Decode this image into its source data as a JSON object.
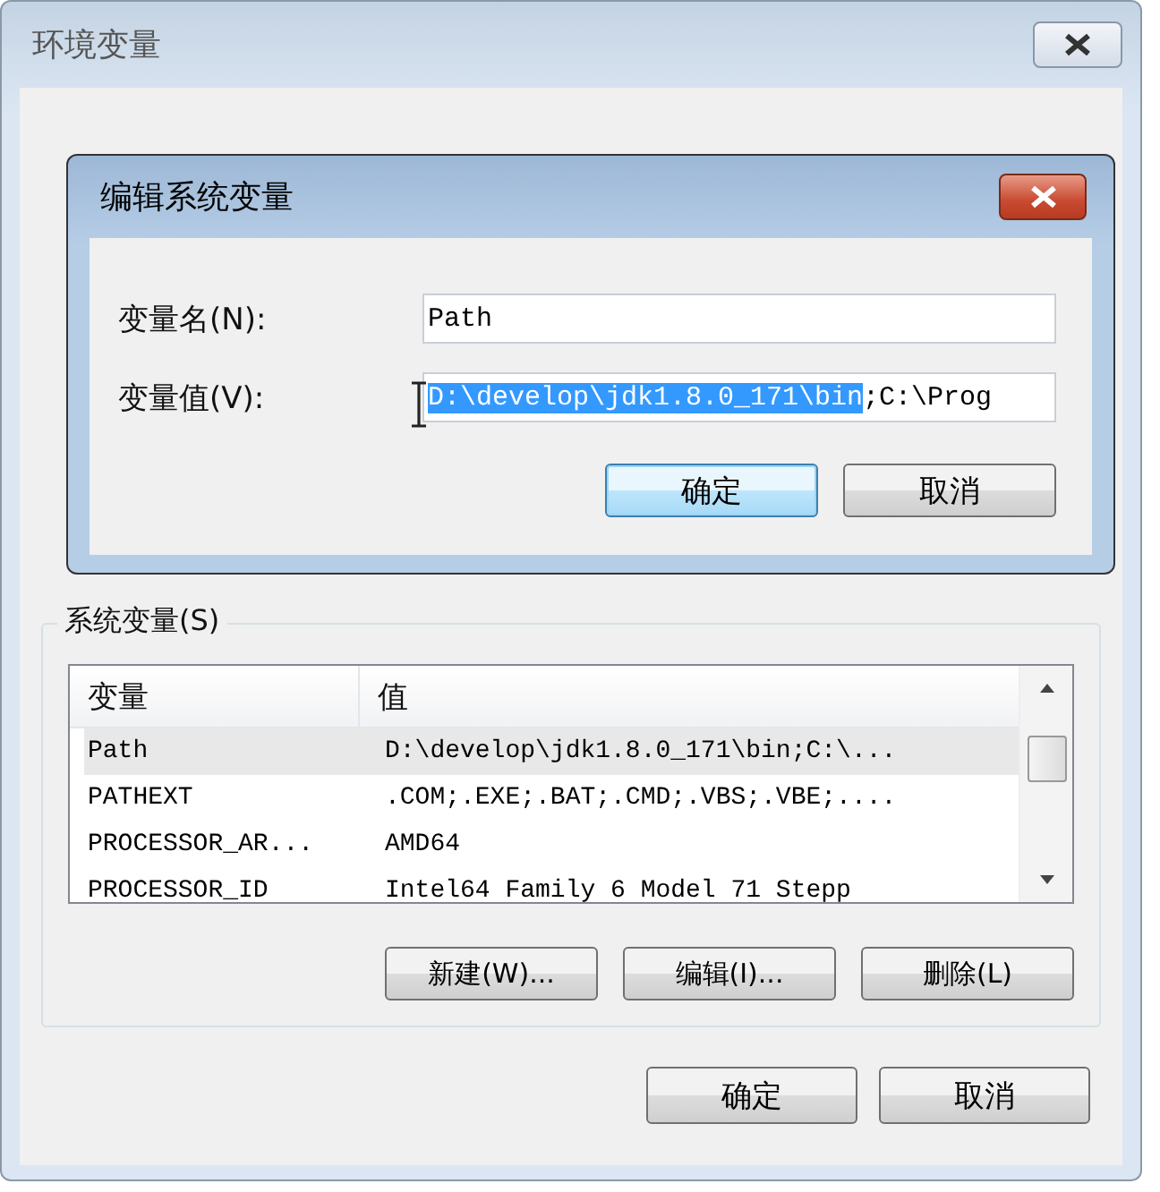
{
  "window": {
    "title": "环境变量"
  },
  "edit_dialog": {
    "title": "编辑系统变量",
    "name_field": {
      "label": "变量名(N):",
      "value": "Path"
    },
    "value_field": {
      "label": "变量值(V):",
      "value_selected": "D:\\develop\\jdk1.8.0_171\\bin",
      "value_rest": ";C:\\Prog"
    },
    "buttons": [
      {
        "label": "确定",
        "default": true
      },
      {
        "label": "取消",
        "default": false
      }
    ]
  },
  "system_variables": {
    "label": "系统变量(S)",
    "columns": [
      "变量",
      "值"
    ],
    "rows": [
      {
        "name": "Path",
        "value": "D:\\develop\\jdk1.8.0_171\\bin;C:\\...",
        "selected": true
      },
      {
        "name": "PATHEXT",
        "value": ".COM;.EXE;.BAT;.CMD;.VBS;.VBE;....",
        "selected": false
      },
      {
        "name": "PROCESSOR_AR...",
        "value": "AMD64",
        "selected": false
      },
      {
        "name": "PROCESSOR_ID",
        "value": "Intel64 Family 6 Model 71 Stepp",
        "selected": false
      }
    ],
    "buttons": [
      "新建(W)...",
      "编辑(I)...",
      "删除(L)"
    ]
  },
  "buttons": [
    "确定",
    "取消"
  ]
}
